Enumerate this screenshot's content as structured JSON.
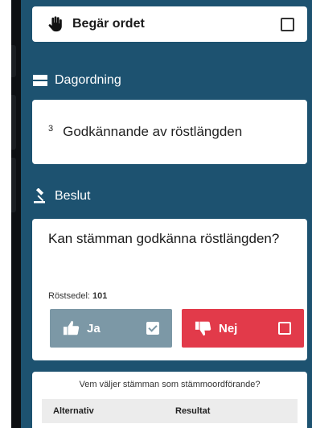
{
  "request": {
    "label": "Begär ordet"
  },
  "agenda": {
    "header": "Dagordning",
    "number": "3",
    "title": "Godkännande av röstlängden"
  },
  "decision": {
    "header": "Beslut",
    "question": "Kan stämman godkänna röstlängden?",
    "ballots_label": "Röstsedel:",
    "ballots_count": "101",
    "yes_label": "Ja",
    "no_label": "Nej"
  },
  "result": {
    "question": "Vem väljer stämman som stämmoordförande?",
    "columns": [
      "Alternativ",
      "Resultat"
    ]
  },
  "colors": {
    "background": "#1d5270",
    "yes": "#7c98a6",
    "no": "#e23a4a"
  }
}
